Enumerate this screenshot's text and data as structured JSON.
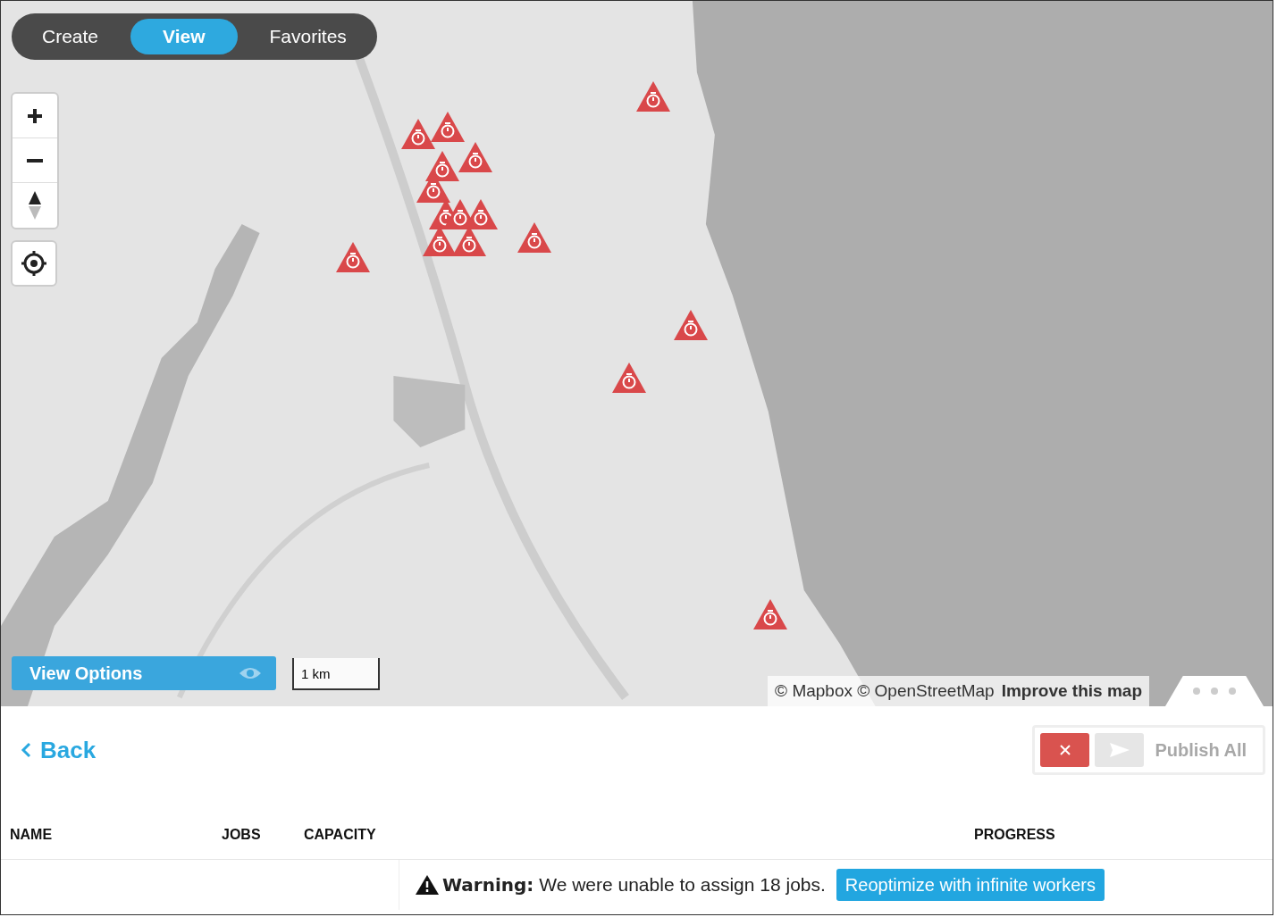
{
  "mode_tabs": [
    {
      "label": "Create",
      "selected": false
    },
    {
      "label": "View",
      "selected": true
    },
    {
      "label": "Favorites",
      "selected": false
    }
  ],
  "map": {
    "view_options": "View Options",
    "scale": "1 km",
    "attribution": "© Mapbox © OpenStreetMap",
    "improve_link": "Improve this map"
  },
  "back": "Back",
  "actions": {
    "publish_label": "Publish All",
    "publish_disabled": true
  },
  "table": {
    "columns": [
      {
        "label": "NAME",
        "kind": "name"
      },
      {
        "label": "JOBS",
        "kind": "jobs"
      },
      {
        "label": "CAPACITY",
        "kind": "capacity"
      },
      {
        "label": "PROGRESS",
        "kind": "progress"
      }
    ]
  },
  "warning": {
    "text": "**Warning:** We were unable to assign 18 jobs.",
    "button": "Reoptimize with infinite workers"
  }
}
